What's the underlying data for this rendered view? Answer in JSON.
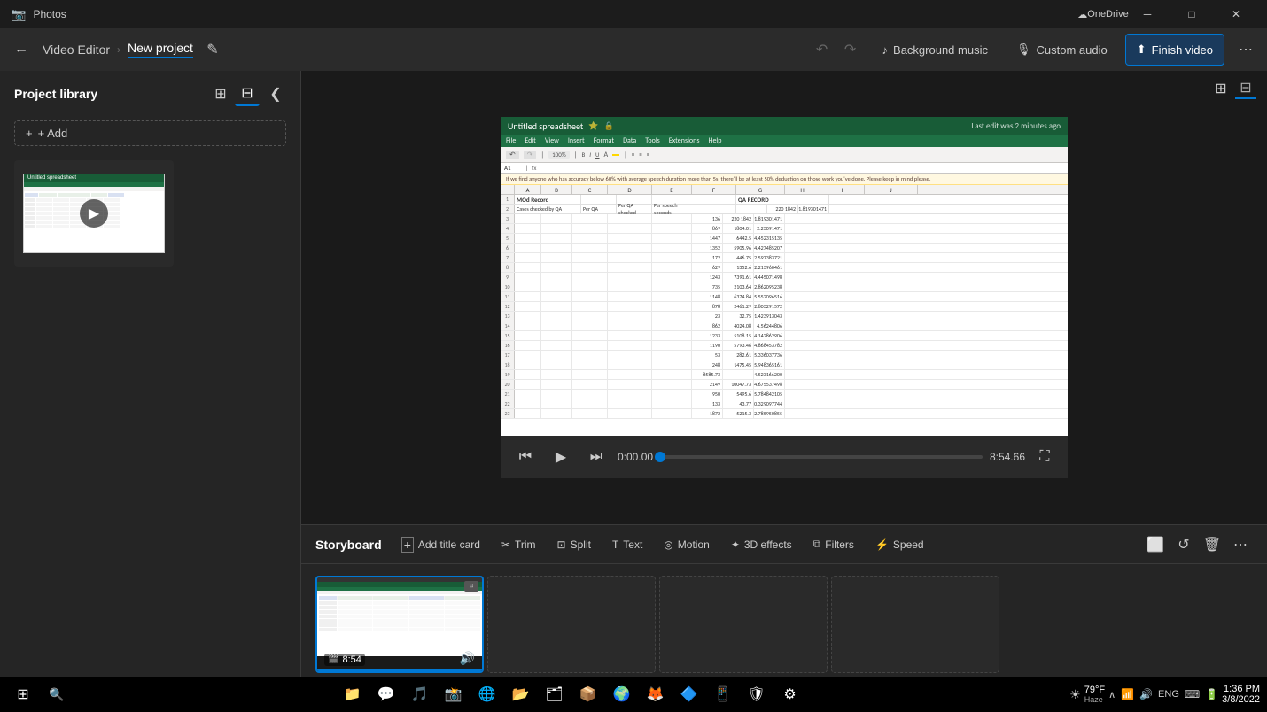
{
  "titlebar": {
    "app_name": "Photos",
    "onedrive": "OneDrive",
    "min": "─",
    "max": "□",
    "close": "✕"
  },
  "appbar": {
    "back_icon": "←",
    "app_label": "Video Editor",
    "separator": ">",
    "project_name": "New project",
    "edit_icon": "✎",
    "undo_icon": "↶",
    "redo_icon": "↷",
    "background_music_label": "Background music",
    "custom_audio_label": "Custom audio",
    "finish_video_label": "Finish video",
    "more_icon": "⋯"
  },
  "project_library": {
    "title": "Project library",
    "collapse_icon": "❮",
    "add_label": "+ Add",
    "view_grid_icon": "⊞",
    "view_list_icon": "⊟"
  },
  "preview": {
    "rewind_icon": "⏮",
    "play_icon": "▶",
    "forward_icon": "⏭",
    "current_time": "0:00.00",
    "total_time": "8:54.66",
    "expand_icon": "⛶",
    "progress_pct": 0
  },
  "storyboard": {
    "title": "Storyboard",
    "tools": [
      {
        "label": "Add title card",
        "icon": "+"
      },
      {
        "label": "Trim",
        "icon": "✂"
      },
      {
        "label": "Split",
        "icon": "⊡"
      },
      {
        "label": "Text",
        "icon": "T"
      },
      {
        "label": "Motion",
        "icon": "◎"
      },
      {
        "label": "3D effects",
        "icon": "✦"
      },
      {
        "label": "Filters",
        "icon": "⧉"
      },
      {
        "label": "Speed",
        "icon": "⚡"
      }
    ],
    "extra_icons": [
      "⬜",
      "↺",
      "🗑",
      "⋯"
    ],
    "clips": [
      {
        "duration": "8:54",
        "has_audio": true,
        "selected": true
      },
      {
        "duration": "",
        "has_audio": false,
        "selected": false
      },
      {
        "duration": "",
        "has_audio": false,
        "selected": false
      },
      {
        "duration": "",
        "has_audio": false,
        "selected": false
      }
    ]
  },
  "spreadsheet": {
    "title": "Untitled spreadsheet",
    "menu_items": [
      "File",
      "Edit",
      "View",
      "Insert",
      "Format",
      "Data",
      "Tools",
      "Extensions",
      "Help"
    ],
    "last_edit": "Last edit was 2 minutes ago",
    "notice": "If we find anyone who has accuracy below 60% with average speech duration more than 5s, there'll be at least 50% deduction on those work you've done. Please keep in mind please.",
    "headers": [
      "MOd Record",
      "",
      "",
      "",
      "",
      "QA RECORD",
      ""
    ],
    "col_headers": [
      "A",
      "B",
      "C",
      "D",
      "E",
      "F",
      "G",
      "H",
      "I",
      "J"
    ],
    "rows": [
      [
        "136",
        "220 1842",
        "1.819301471"
      ],
      [
        "869",
        "1804.01",
        "2.23091471"
      ],
      [
        "1447",
        "6442.5",
        "4.452315135"
      ],
      [
        "1352",
        "5905.96",
        "4.427485207"
      ],
      [
        "172",
        "446.75",
        "2.597383721"
      ],
      [
        "629",
        "1352.6",
        "2.213960461"
      ],
      [
        "1243",
        "7391.61",
        "4.445071498"
      ],
      [
        "735",
        "2103.64",
        "2.862095238"
      ],
      [
        "1148",
        "6374.84",
        "5.552096516"
      ],
      [
        "878",
        "2461.29",
        "2.803291572"
      ],
      [
        "23",
        "32.75",
        "1.423913043"
      ],
      [
        "862",
        "4024.08",
        "4.56244806"
      ],
      [
        "1233",
        "5108.15",
        "4.142862906"
      ],
      [
        "1190",
        "5793.46",
        "4.868453782"
      ],
      [
        "53",
        "282.61",
        "5.336037736"
      ],
      [
        "248",
        "1475.45",
        "5.948365161"
      ],
      [
        "8585.73",
        "",
        "4.523166200"
      ],
      [
        "2149",
        "10047.73",
        "4.675537498"
      ],
      [
        "950",
        "5495.6",
        "5.784842105"
      ],
      [
        "133",
        "43.77",
        "0.329097744"
      ],
      [
        "1872",
        "5215.3",
        "2.785950855"
      ]
    ]
  },
  "taskbar": {
    "start_icon": "⊞",
    "search_icon": "🔍",
    "apps": [
      "📁",
      "💬",
      "🎵",
      "📸",
      "🌐",
      "📂",
      "🗂",
      "📦",
      "🌍",
      "🦊",
      "🔷",
      "📱",
      "🛡",
      "⚙"
    ],
    "weather": "79°F",
    "weather_condition": "Haze",
    "weather_icon": "☀",
    "time": "1:36 PM",
    "date": "3/8/2022",
    "lang": "ENG"
  }
}
